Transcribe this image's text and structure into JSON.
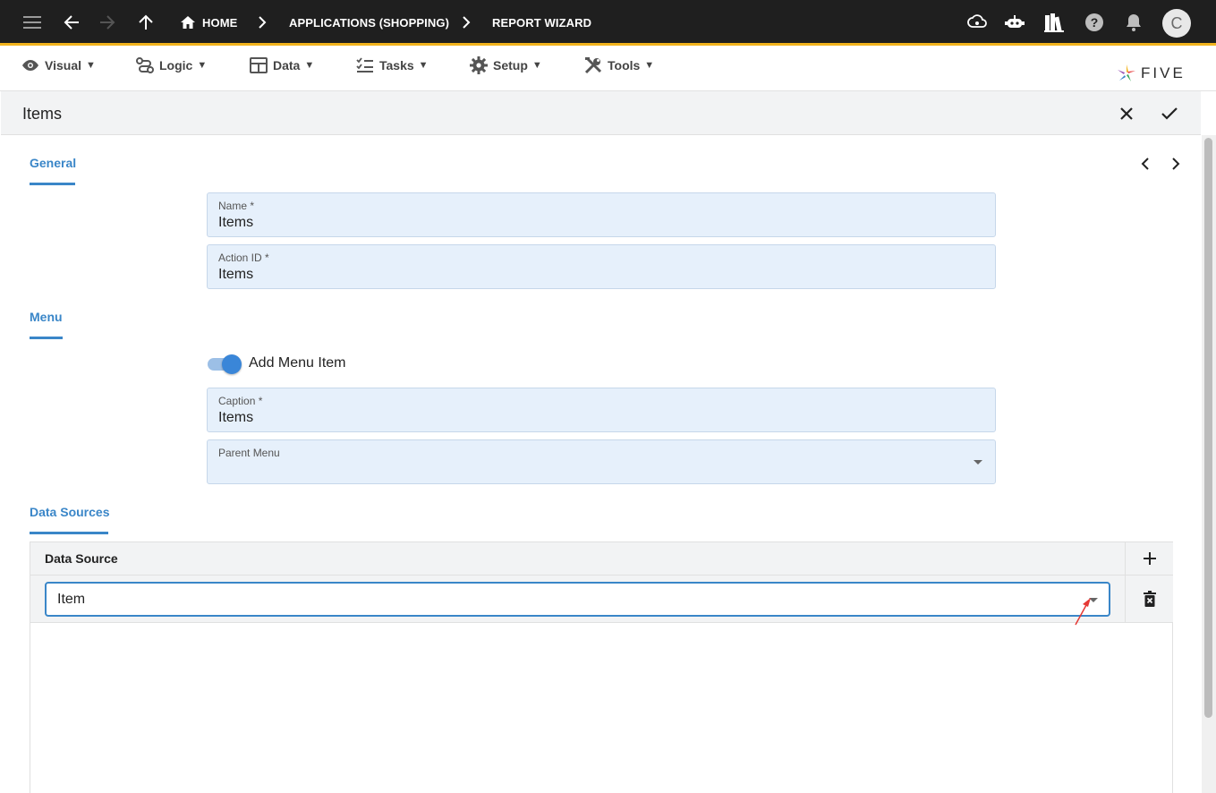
{
  "topbar": {
    "breadcrumbs": [
      {
        "label": "HOME",
        "icon": "home-icon"
      },
      {
        "label": "APPLICATIONS (SHOPPING)"
      },
      {
        "label": "REPORT WIZARD"
      }
    ],
    "avatar_initial": "C",
    "accent_color": "#f2b31d"
  },
  "menubar": {
    "items": [
      {
        "label": "Visual",
        "icon": "eye-icon"
      },
      {
        "label": "Logic",
        "icon": "logic-icon"
      },
      {
        "label": "Data",
        "icon": "table-icon"
      },
      {
        "label": "Tasks",
        "icon": "checklist-icon"
      },
      {
        "label": "Setup",
        "icon": "gear-icon"
      },
      {
        "label": "Tools",
        "icon": "tools-icon"
      }
    ],
    "caret": "▼",
    "logo_text": "FIVE"
  },
  "form": {
    "title": "Items",
    "sections": {
      "general": "General",
      "menu": "Menu",
      "data_sources": "Data Sources"
    },
    "fields": {
      "name": {
        "label": "Name *",
        "value": "Items"
      },
      "action_id": {
        "label": "Action ID *",
        "value": "Items"
      },
      "caption": {
        "label": "Caption *",
        "value": "Items"
      },
      "parent_menu": {
        "label": "Parent Menu",
        "value": ""
      }
    },
    "add_menu_item": {
      "label": "Add Menu Item",
      "checked": true
    },
    "data_source_grid": {
      "column": "Data Source",
      "rows": [
        {
          "value": "Item"
        }
      ]
    },
    "accent_color": "#3a86c8"
  }
}
